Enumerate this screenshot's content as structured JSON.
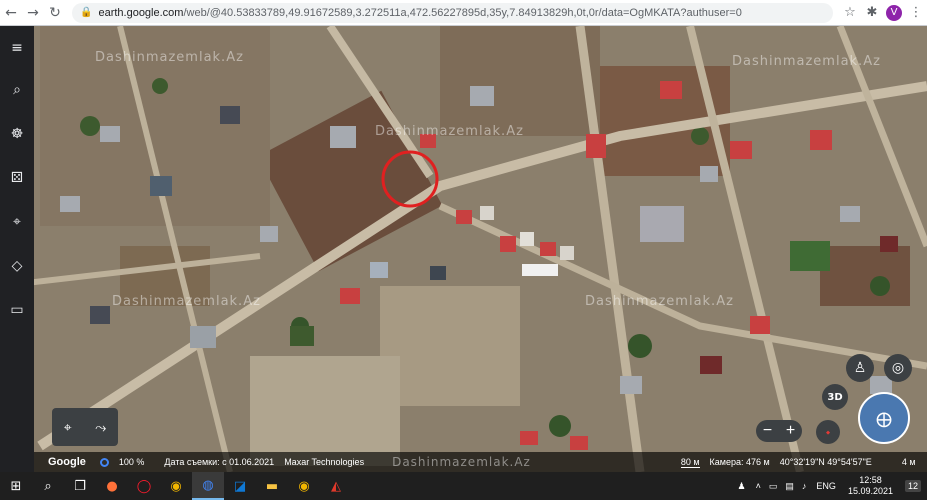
{
  "browser": {
    "url_domain": "earth.google.com",
    "url_rest": "/web/@40.53833789,49.91672589,3.272511a,472.56227895d,35y,7.84913829h,0t,0r/data=OgMKATA?authuser=0",
    "profile_initial": "V"
  },
  "map": {
    "watermark_text": "Dashinmazemlak.Az",
    "watermark_bottom": "Dashinmazemlak.Az",
    "marker_color": "#e02020"
  },
  "controls": {
    "three_d_label": "3D",
    "zoom_minus": "−",
    "zoom_plus": "+"
  },
  "status": {
    "logo": "Google",
    "load_percent": "100 %",
    "imagery_date": "Дата съемки: с 01.06.2021",
    "provider": "Maxar Technologies",
    "scale": "80 м",
    "camera": "Камера: 476 м",
    "coords": "40°32'19\"N 49°54'57\"E",
    "elevation": "4 м"
  },
  "taskbar": {
    "lang": "ENG",
    "time": "12:58",
    "date": "15.09.2021",
    "notif_count": "12"
  }
}
